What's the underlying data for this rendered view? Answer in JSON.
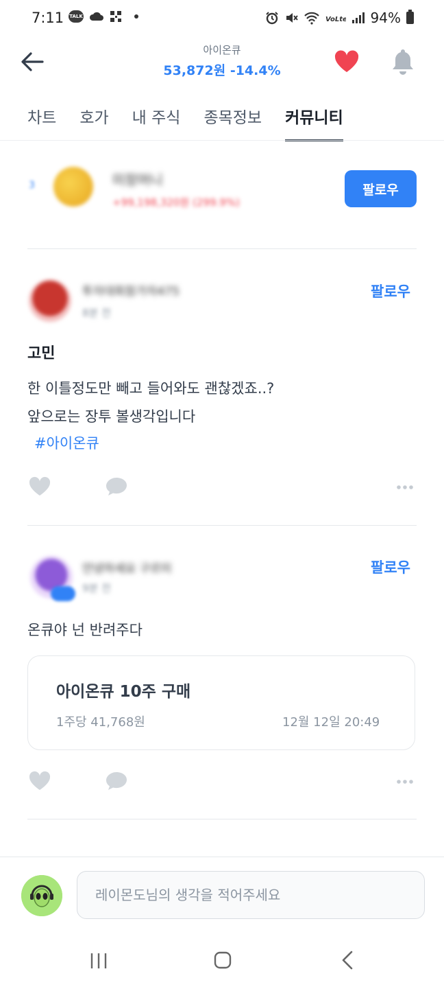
{
  "status_bar": {
    "time": "7:11",
    "talk_label": "TALK",
    "battery": "94%"
  },
  "header": {
    "stock_name": "아이온큐",
    "price": "53,872원",
    "change": "-14.4%"
  },
  "tabs": [
    "차트",
    "호가",
    "내 주식",
    "종목정보",
    "커뮤니티"
  ],
  "active_tab": "커뮤니티",
  "recommended": {
    "rank": "3",
    "name": "미장머니",
    "profit": "+99,198,320원 (299.9%)",
    "follow_label": "팔로우"
  },
  "posts": [
    {
      "author": "투자대회참가자475",
      "time": "8분 전",
      "follow_label": "팔로우",
      "title": "고민",
      "body_lines": [
        "한 이틀정도만 빼고 들어와도 괜찮겠죠..?",
        "앞으로는 장투 볼생각입니다"
      ],
      "hashtag": "#아이온큐"
    },
    {
      "author": "안녕하세요 구르미",
      "time": "9분 전",
      "follow_label": "팔로우",
      "body": "온큐야 넌 반려주다",
      "trade": {
        "title": "아이온큐 10주 구매",
        "price": "1주당 41,768원",
        "time": "12월 12일 20:49"
      }
    }
  ],
  "comment": {
    "placeholder": "레이몬도님의 생각을 적어주세요"
  },
  "colors": {
    "accent": "#3182f6",
    "like_heart": "#f04452",
    "negative": "#f04452"
  }
}
